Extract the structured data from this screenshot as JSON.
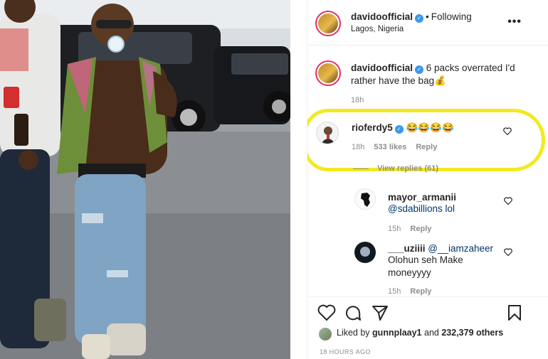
{
  "post": {
    "author": "davidoofficial",
    "separator": "•",
    "following_label": "Following",
    "location": "Lagos, Nigeria",
    "more_label": "•••"
  },
  "caption": {
    "author": "davidoofficial",
    "text": "6 packs overrated I'd rather have the bag💰",
    "time": "18h"
  },
  "comments": [
    {
      "author": "rioferdy5",
      "text": "😂😂😂😂",
      "time": "18h",
      "likes": "533 likes",
      "reply": "Reply"
    }
  ],
  "view_replies": "View replies (61)",
  "replies": [
    {
      "author": "mayor_armanii",
      "text": "@sdabillions lol",
      "time": "15h",
      "reply": "Reply"
    },
    {
      "author": "___uziiii",
      "mention": "@__iamzaheer",
      "text": "Olohun seh Make moneyyyy",
      "time": "15h",
      "reply": "Reply"
    }
  ],
  "liked_by": {
    "prefix": "Liked by",
    "user": "gunnplaay1",
    "middle": "and",
    "others": "232,379 others"
  },
  "time_ago": "18 HOURS AGO",
  "colors": {
    "highlight": "#f2ea1f",
    "verified": "#3897f0",
    "link": "#00376b",
    "meta": "#8e8e8e"
  }
}
